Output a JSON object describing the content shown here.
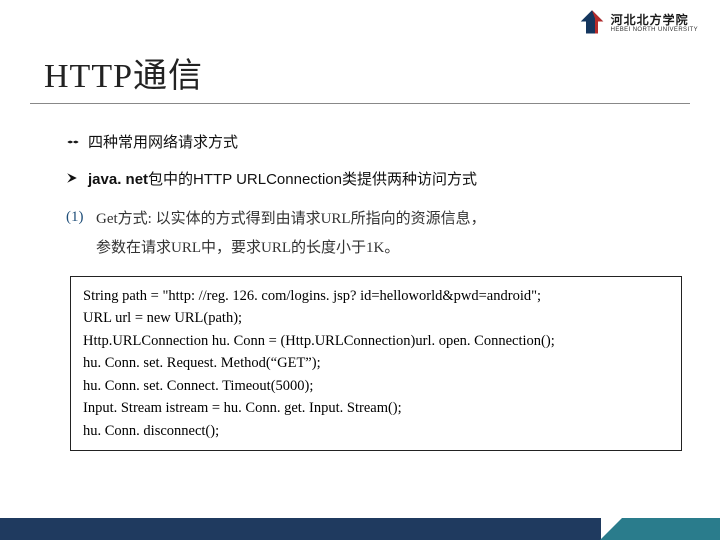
{
  "logo": {
    "cn": "河北北方学院",
    "en": "HEBEI NORTH UNIVERSITY"
  },
  "title": {
    "en": "HTTP",
    "cn": "通信"
  },
  "bullets": {
    "first": "四种常用网络请求方式",
    "second_prefix": "java. net",
    "second_rest": "包中的HTTP URLConnection类提供两种访问方式"
  },
  "item1": {
    "num": "(1)",
    "line1": "Get方式: 以实体的方式得到由请求URL所指向的资源信息，",
    "line2": "参数在请求URL中，要求URL的长度小于1K。"
  },
  "code": {
    "l1": "String path = \"http: //reg. 126. com/logins. jsp? id=helloworld&pwd=android\";",
    "l2": "URL url = new URL(path);",
    "l3": "Http.URLConnection hu. Conn = (Http.URLConnection)url. open. Connection();",
    "l4": "hu. Conn. set. Request. Method(“GET”);",
    "l5": "hu. Conn. set. Connect. Timeout(5000);",
    "l6": "Input. Stream istream = hu. Conn. get. Input. Stream();",
    "l7": "hu. Conn. disconnect();"
  }
}
